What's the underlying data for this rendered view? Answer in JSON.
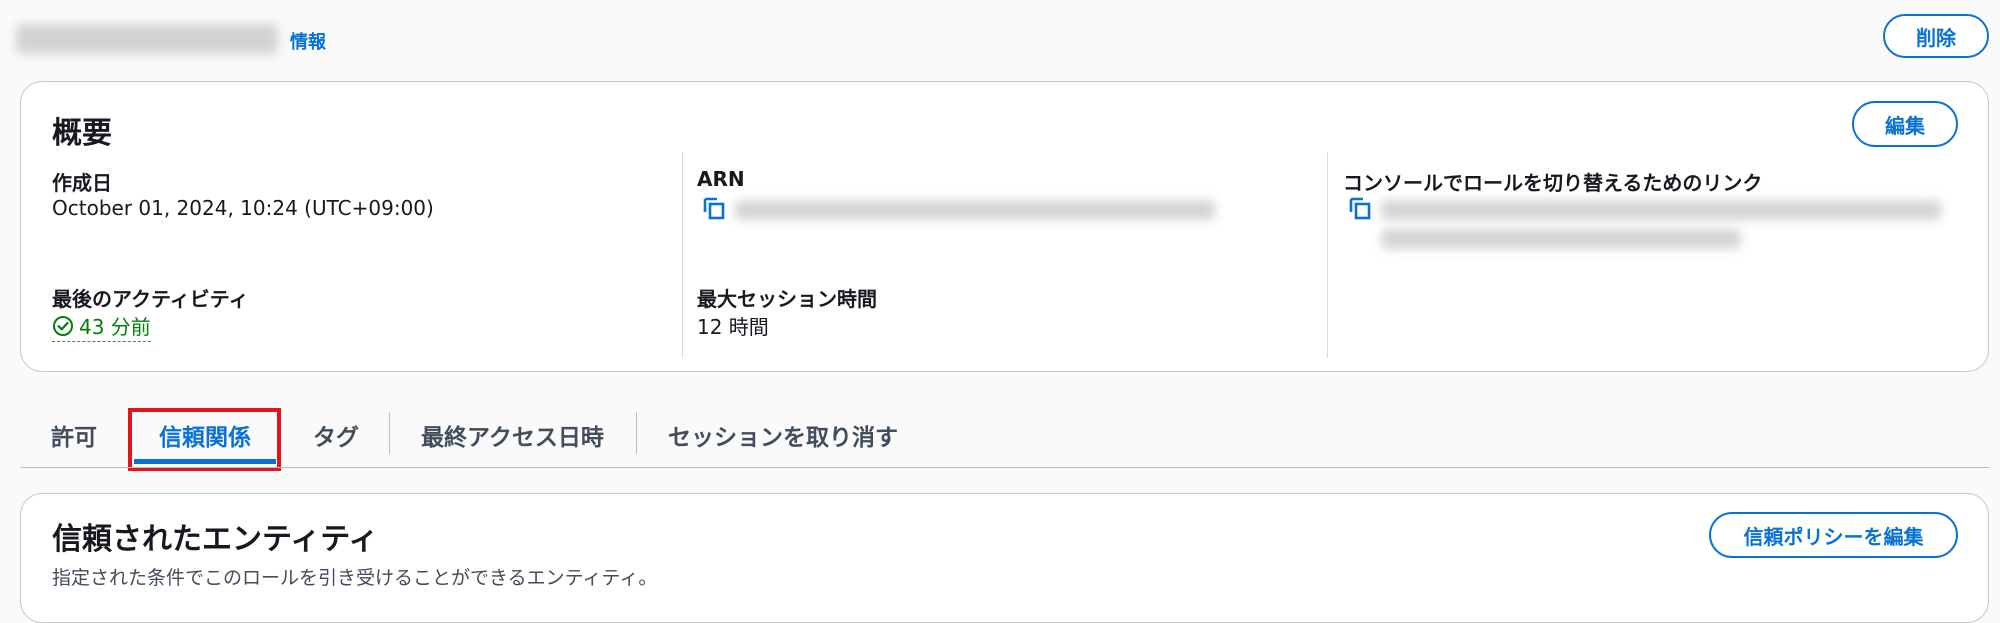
{
  "header": {
    "info_link": "情報",
    "delete_label": "削除"
  },
  "summary": {
    "title": "概要",
    "edit_label": "編集",
    "created": {
      "label": "作成日",
      "value": "October 01, 2024, 10:24 (UTC+09:00)"
    },
    "arn": {
      "label": "ARN"
    },
    "console_link": {
      "label": "コンソールでロールを切り替えるためのリンク"
    },
    "last_activity": {
      "label": "最後のアクティビティ",
      "value": "43 分前"
    },
    "max_session": {
      "label": "最大セッション時間",
      "value": "12 時間"
    }
  },
  "tabs": [
    {
      "label": "許可"
    },
    {
      "label": "信頼関係",
      "active": true
    },
    {
      "label": "タグ"
    },
    {
      "label": "最終アクセス日時"
    },
    {
      "label": "セッションを取り消す"
    }
  ],
  "trusted_entities": {
    "title": "信頼されたエンティティ",
    "description": "指定された条件でこのロールを引き受けることができるエンティティ。",
    "edit_policy_label": "信頼ポリシーを編集"
  },
  "colors": {
    "accent": "#0972d3",
    "success": "#037f0c",
    "highlight_box": "#e5141b"
  },
  "icons": [
    "copy-icon",
    "check-circle-icon"
  ]
}
